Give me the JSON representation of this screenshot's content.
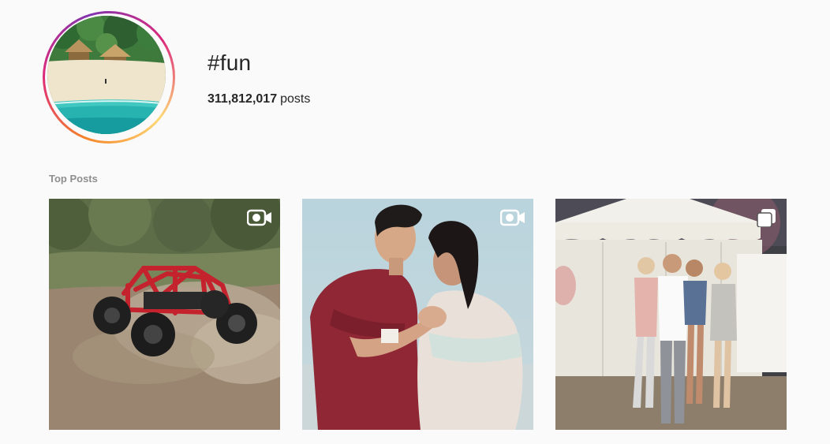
{
  "header": {
    "hashtag": "#fun",
    "post_count": "311,812,017",
    "post_count_unit": "posts"
  },
  "sections": {
    "top_posts_title": "Top Posts"
  },
  "top_posts": [
    {
      "type": "video",
      "badge_icon": "video-camera-icon",
      "subject": "red off-road buggy on dirt track"
    },
    {
      "type": "video",
      "badge_icon": "video-camera-icon",
      "subject": "couple dancing"
    },
    {
      "type": "carousel",
      "badge_icon": "multiple-photos-icon",
      "subject": "group of four people in front of white tent"
    }
  ],
  "colors": {
    "background": "#fafafa",
    "text_primary": "#262626",
    "text_secondary": "#8e8e8e",
    "avatar_ring_gradient": [
      "#f58529",
      "#dd2a7b",
      "#8134af",
      "#feda77"
    ]
  }
}
